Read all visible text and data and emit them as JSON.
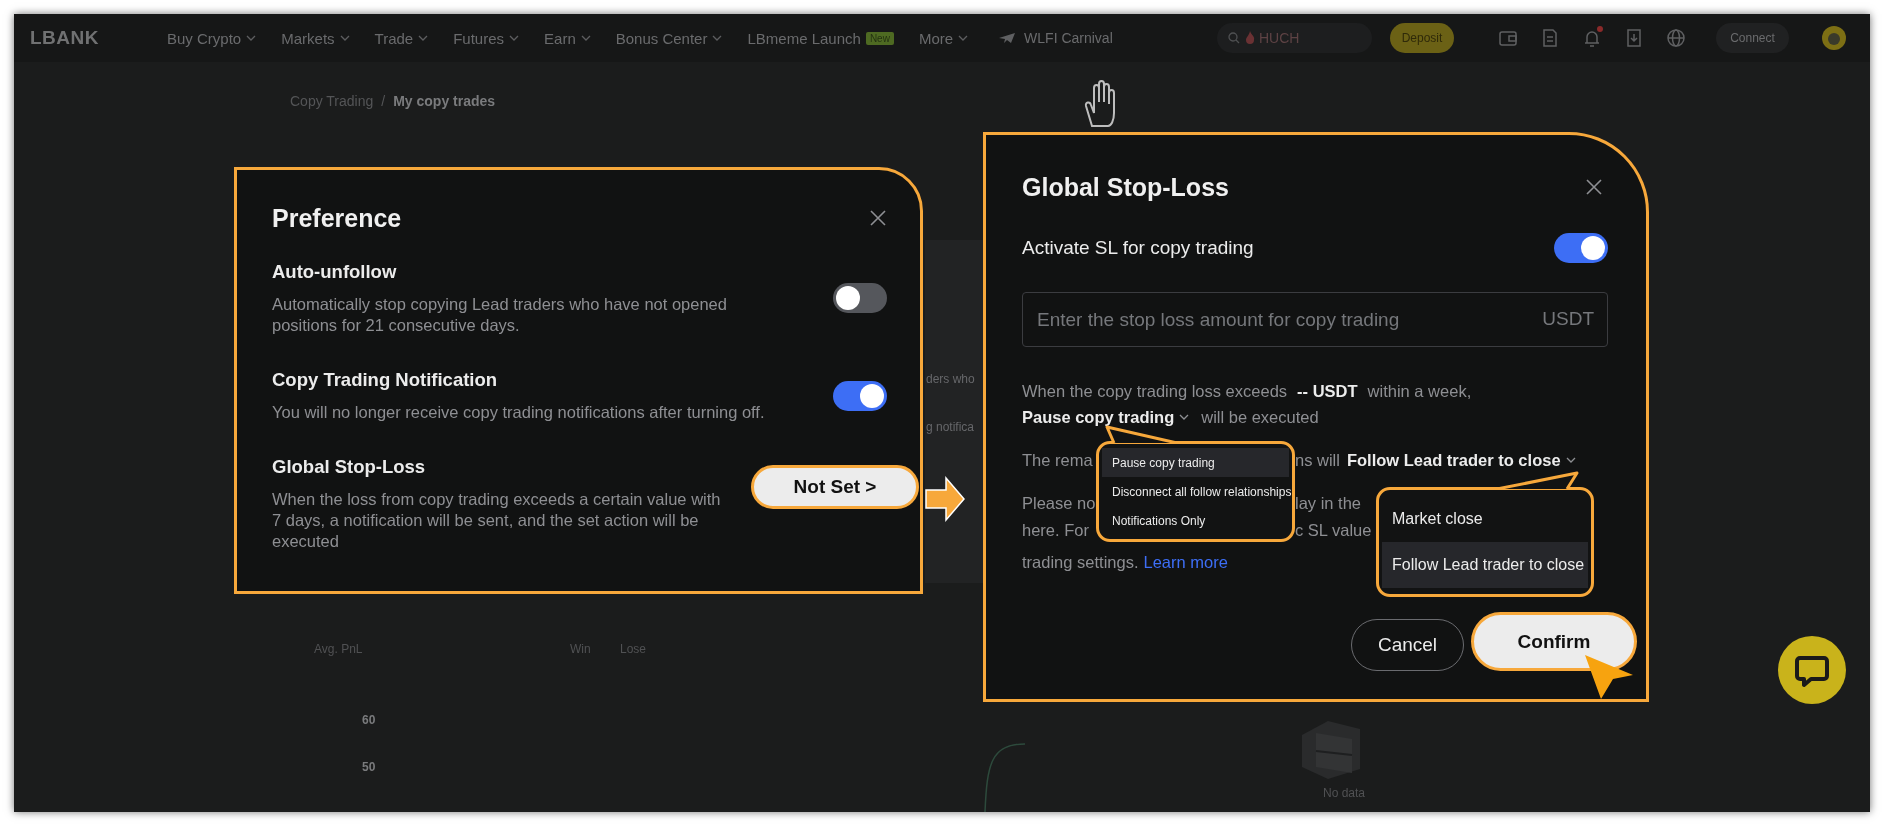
{
  "nav": {
    "logo": "LBANK",
    "items": [
      {
        "label": "Buy Crypto",
        "dropdown": true
      },
      {
        "label": "Markets",
        "dropdown": true
      },
      {
        "label": "Trade",
        "dropdown": true
      },
      {
        "label": "Futures",
        "dropdown": true
      },
      {
        "label": "Earn",
        "dropdown": true
      },
      {
        "label": "Bonus Center",
        "dropdown": true
      },
      {
        "label": "LBmeme Launch",
        "dropdown": false,
        "badge": "New"
      },
      {
        "label": "More",
        "dropdown": true
      }
    ],
    "promo": "WLFI Carnival",
    "search": {
      "placeholder": "HUCH"
    },
    "deposit": "Deposit",
    "notification_dot": true,
    "connect": "Connect"
  },
  "breadcrumb": {
    "items": [
      "Copy Trading",
      "My copy trades"
    ],
    "separator": "/"
  },
  "background": {
    "fragments": [
      "ders who",
      "g notifica"
    ],
    "stat_labels": [
      "Avg. PnL",
      "Win",
      "Lose"
    ],
    "y_ticks": [
      "60",
      "50"
    ],
    "empty_text": "No data"
  },
  "preference": {
    "title": "Preference",
    "items": [
      {
        "kind": "toggle",
        "title": "Auto-unfollow",
        "description": "Automatically stop copying Lead traders who have not opened\npositions for 21 consecutive days.",
        "on": false
      },
      {
        "kind": "toggle",
        "title": "Copy Trading Notification",
        "description": "You will no longer receive copy trading notifications after turning off.",
        "on": true
      },
      {
        "kind": "action",
        "title": "Global Stop-Loss",
        "description": "When the loss from copy trading exceeds a certain value with\n7 days, a notification will be sent, and the set action will be\nexecuted",
        "action": "Not Set >"
      }
    ]
  },
  "stop_loss": {
    "title": "Global Stop-Loss",
    "activate": {
      "label": "Activate SL for copy trading",
      "on": true
    },
    "input": {
      "placeholder": "Enter the stop loss amount for copy trading",
      "suffix": "USDT"
    },
    "rule": {
      "text": "When the copy trading loss exceeds",
      "amount": "-- USDT",
      "tail": "within a week,",
      "action": "Pause copy trading",
      "after": "will be executed"
    },
    "remaining": {
      "start": "The rema",
      "end": "ns will",
      "action": "Follow Lead trader to close"
    },
    "note_fragments": [
      [
        "Please no",
        "lay in the"
      ],
      [
        "here. For",
        "c SL value"
      ]
    ],
    "note_end": {
      "text": "trading settings.",
      "link": "Learn more"
    },
    "action_menu": [
      {
        "label": "Pause copy trading",
        "selected": true
      },
      {
        "label": "Disconnect all follow relationships",
        "selected": false
      },
      {
        "label": "Notifications Only",
        "selected": false
      }
    ],
    "close_menu": [
      {
        "label": "Market close",
        "selected": false
      },
      {
        "label": "Follow Lead trader to close",
        "selected": true
      }
    ],
    "cancel": "Cancel",
    "confirm": "Confirm"
  }
}
